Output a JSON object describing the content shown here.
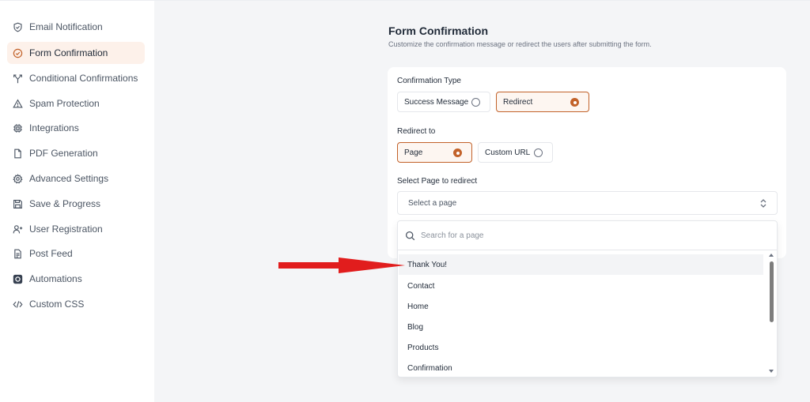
{
  "sidebar": {
    "items": [
      {
        "label": "Email Notification",
        "icon": "shield-check-icon",
        "active": false
      },
      {
        "label": "Form Confirmation",
        "icon": "check-circle-icon",
        "active": true
      },
      {
        "label": "Conditional Confirmations",
        "icon": "split-arrows-icon",
        "active": false
      },
      {
        "label": "Spam Protection",
        "icon": "warning-triangle-icon",
        "active": false
      },
      {
        "label": "Integrations",
        "icon": "chip-icon",
        "active": false
      },
      {
        "label": "PDF Generation",
        "icon": "document-icon",
        "active": false
      },
      {
        "label": "Advanced Settings",
        "icon": "gear-icon",
        "active": false
      },
      {
        "label": "Save & Progress",
        "icon": "floppy-disk-icon",
        "active": false
      },
      {
        "label": "User Registration",
        "icon": "user-plus-icon",
        "active": false
      },
      {
        "label": "Post Feed",
        "icon": "post-document-icon",
        "active": false
      },
      {
        "label": "Automations",
        "icon": "automation-icon",
        "active": false
      },
      {
        "label": "Custom CSS",
        "icon": "code-icon",
        "active": false
      }
    ]
  },
  "header": {
    "title": "Form Confirmation",
    "subtitle": "Customize the confirmation message or redirect the users after submitting the form."
  },
  "confirmation_type": {
    "label": "Confirmation Type",
    "options": [
      {
        "label": "Success Message",
        "selected": false
      },
      {
        "label": "Redirect",
        "selected": true
      }
    ]
  },
  "redirect_to": {
    "label": "Redirect to",
    "options": [
      {
        "label": "Page",
        "selected": true
      },
      {
        "label": "Custom URL",
        "selected": false
      }
    ]
  },
  "page_select": {
    "label": "Select Page to redirect",
    "placeholder": "Select a page",
    "search_placeholder": "Search for a page",
    "options": [
      "Thank You!",
      "Contact",
      "Home",
      "Blog",
      "Products",
      "Confirmation"
    ],
    "highlighted_index": 0
  },
  "colors": {
    "accent": "#c2622a",
    "active_bg": "#fdf1ea",
    "annotation_arrow": "#e11d1d"
  }
}
